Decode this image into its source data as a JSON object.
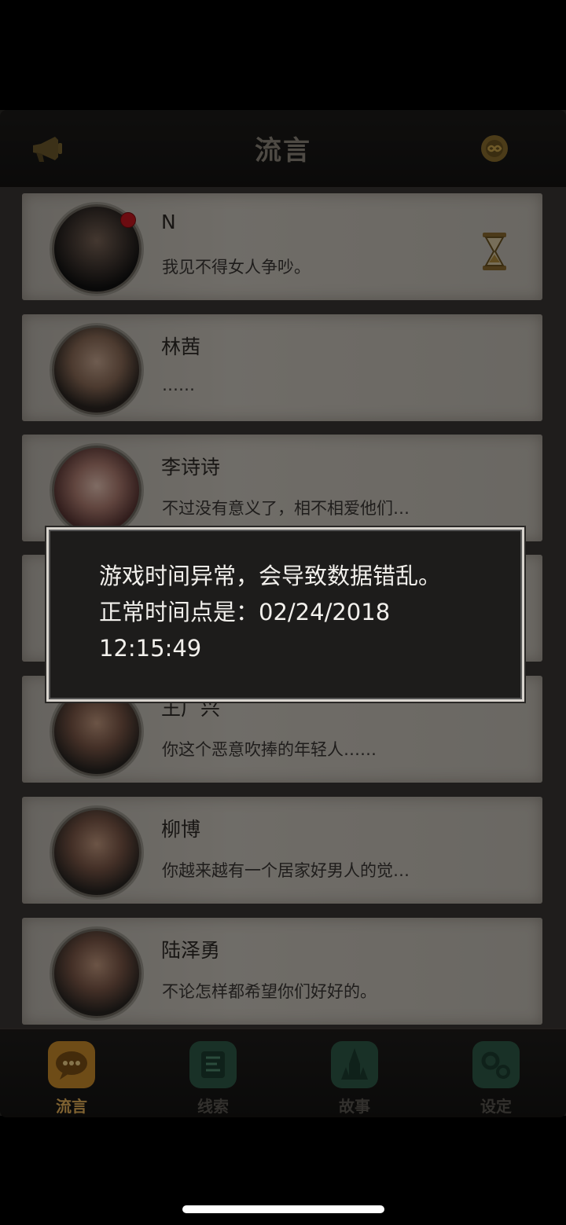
{
  "header": {
    "title": "流言"
  },
  "rumors": [
    {
      "name": "N",
      "message": "我见不得女人争吵。",
      "unread": true,
      "pending": true
    },
    {
      "name": "林茜",
      "message": "……"
    },
    {
      "name": "李诗诗",
      "message": "不过没有意义了，相不相爱他们…"
    },
    {
      "name": "",
      "message": ""
    },
    {
      "name": "王广兴",
      "message": "你这个恶意吹捧的年轻人……"
    },
    {
      "name": "柳博",
      "message": "你越来越有一个居家好男人的觉…"
    },
    {
      "name": "陆泽勇",
      "message": "不论怎样都希望你们好好的。"
    }
  ],
  "dialog": {
    "line1": "游戏时间异常，会导致数据错乱。",
    "line2": "正常时间点是：02/24/2018",
    "line3": "12:15:49"
  },
  "tabs": [
    {
      "label": "流言",
      "active": true
    },
    {
      "label": "线索",
      "active": false
    },
    {
      "label": "故事",
      "active": false
    },
    {
      "label": "设定",
      "active": false
    }
  ],
  "colors": {
    "active_tab": "#c98a2a",
    "inactive_tab": "#2f5a47",
    "unread_dot": "#c5161f"
  }
}
